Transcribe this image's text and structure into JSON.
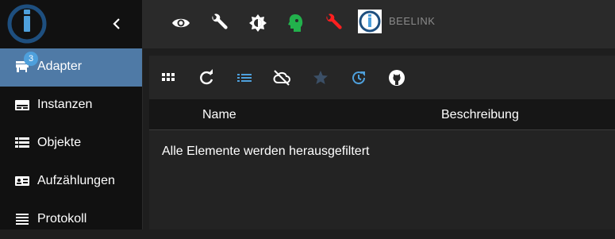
{
  "sidebar": {
    "collapse_icon": "chevron-left-icon",
    "items": [
      {
        "label": "Adapter",
        "icon": "store-icon",
        "badge": "3",
        "active": true
      },
      {
        "label": "Instanzen",
        "icon": "instances-icon"
      },
      {
        "label": "Objekte",
        "icon": "list-icon"
      },
      {
        "label": "Aufzählungen",
        "icon": "enum-icon"
      },
      {
        "label": "Protokoll",
        "icon": "log-icon"
      }
    ]
  },
  "topbar": {
    "icons": [
      "eye-icon",
      "wrench-icon",
      "theme-toggle-icon",
      "expert-head-icon",
      "red-wrench-icon"
    ],
    "host_name": "BEELINK"
  },
  "toolbar": {
    "icons": [
      "grid-icon",
      "refresh-icon",
      "list-view-icon",
      "cloud-off-icon",
      "star-icon",
      "update-icon",
      "github-icon"
    ]
  },
  "table": {
    "columns": [
      "Name",
      "Beschreibung"
    ],
    "empty_message": "Alle Elemente werden herausgefiltert"
  },
  "colors": {
    "active_item": "#4f7aa6",
    "accent_blue": "#4ea0dc",
    "green": "#22b14c",
    "red": "#ff1f1f",
    "star_dim": "#3b4f66"
  }
}
